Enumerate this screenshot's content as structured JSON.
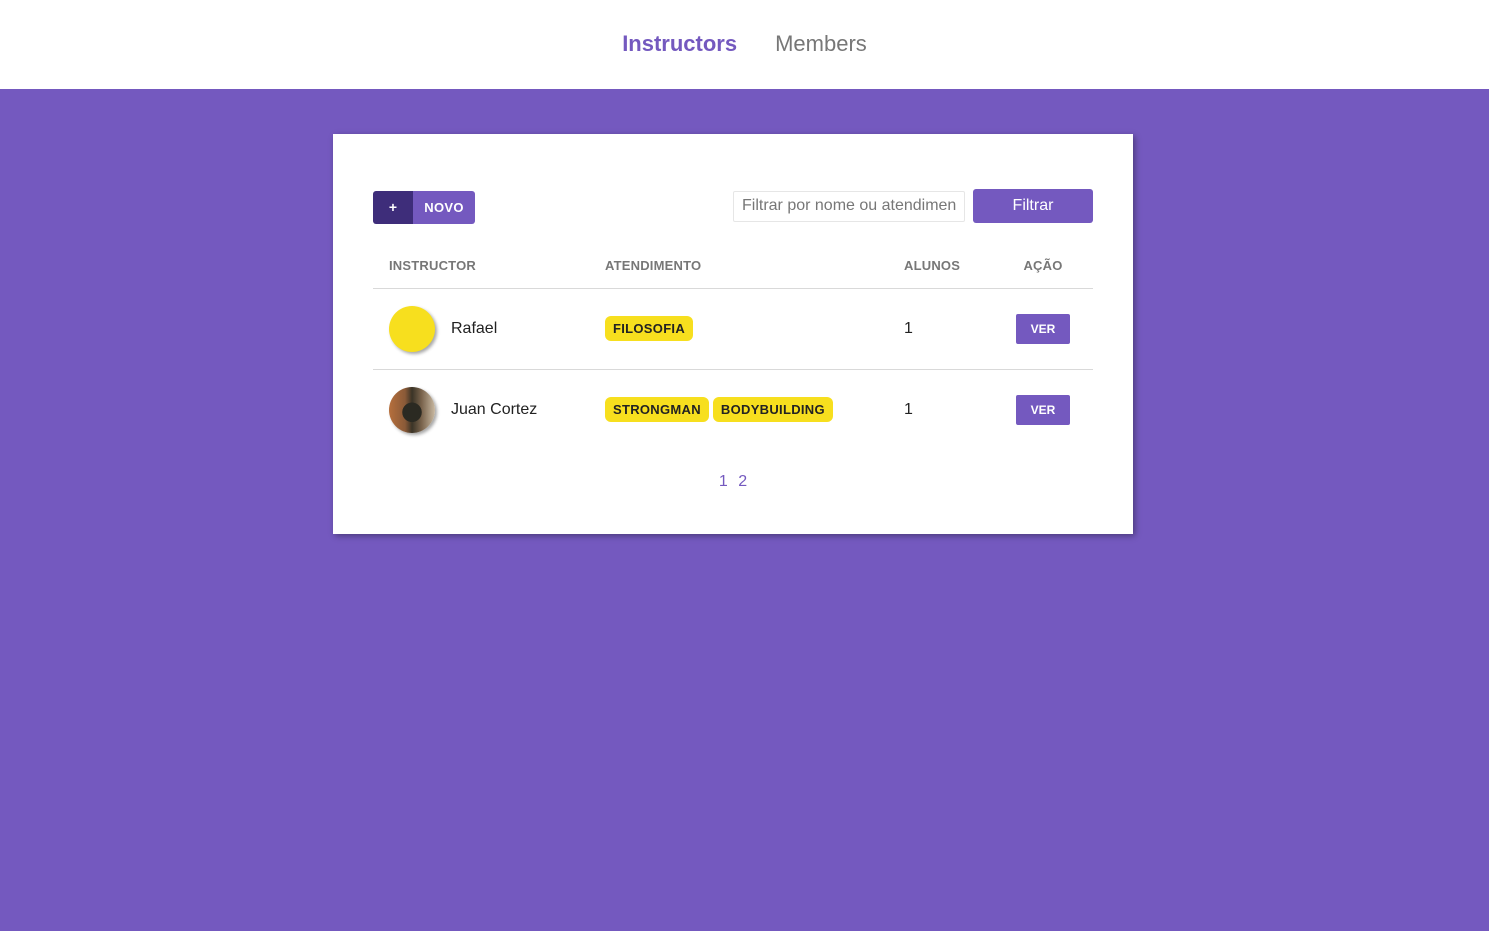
{
  "nav": {
    "items": [
      {
        "label": "Instructors",
        "active": true
      },
      {
        "label": "Members",
        "active": false
      }
    ]
  },
  "toolbar": {
    "new_icon": "+",
    "new_label": "NOVO",
    "filter_placeholder": "Filtrar por nome ou atendimento",
    "filter_button": "Filtrar"
  },
  "table": {
    "headers": [
      "INSTRUCTOR",
      "ATENDIMENTO",
      "ALUNOS",
      "AÇÃO"
    ],
    "rows": [
      {
        "name": "Rafael",
        "avatar": "yellow-avatar",
        "services": [
          "FILOSOFIA"
        ],
        "students": "1",
        "action": "VER"
      },
      {
        "name": "Juan Cortez",
        "avatar": "photo-avatar",
        "services": [
          "STRONGMAN",
          "BODYBUILDING"
        ],
        "students": "1",
        "action": "VER"
      }
    ]
  },
  "pagination": {
    "pages": [
      "1",
      "2"
    ]
  },
  "colors": {
    "accent": "#7459bf",
    "accent_dark": "#3e2d7a",
    "tag": "#f7df1e"
  }
}
